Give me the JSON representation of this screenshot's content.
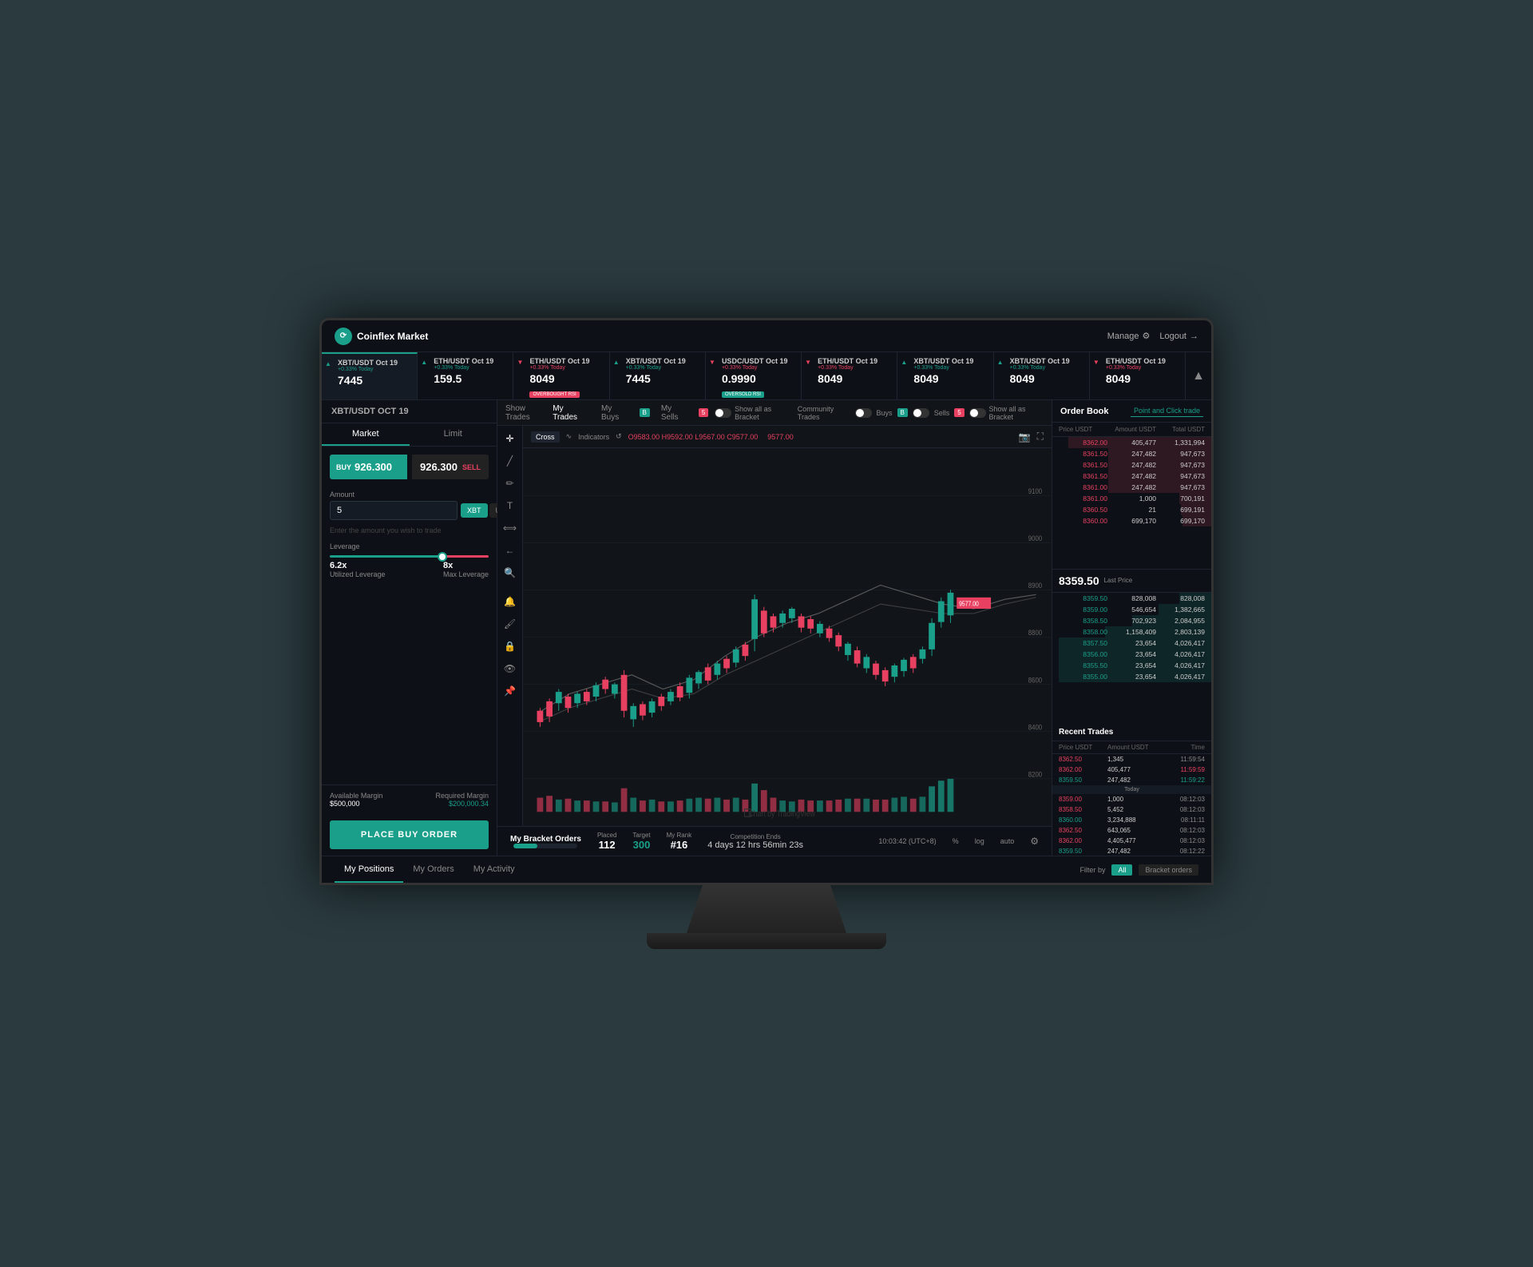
{
  "app": {
    "title": "Coinflex Market",
    "manage_label": "Manage",
    "logout_label": "Logout"
  },
  "ticker": {
    "items": [
      {
        "symbol": "XBT/USDT Oct 19",
        "change": "+0.33% Today",
        "price": "7445",
        "direction": "up",
        "badge": null
      },
      {
        "symbol": "ETH/USDT Oct 19",
        "change": "+0.33% Today",
        "price": "159.5",
        "direction": "up",
        "badge": null
      },
      {
        "symbol": "ETH/USDT Oct 19",
        "change": "+0.33% Today",
        "price": "8049",
        "direction": "down",
        "badge": "OVERBOUGHT RSI"
      },
      {
        "symbol": "XBT/USDT Oct 19",
        "change": "+0.33% Today",
        "price": "7445",
        "direction": "up",
        "badge": null
      },
      {
        "symbol": "USDC/USDT Oct 19",
        "change": "+0.33% Today",
        "price": "0.9990",
        "direction": "down",
        "badge": "OVERSOLD RSI"
      },
      {
        "symbol": "ETH/USDT Oct 19",
        "change": "+0.33% Today",
        "price": "8049",
        "direction": "down",
        "badge": null
      },
      {
        "symbol": "XBT/USDT Oct 19",
        "change": "+0.33% Today",
        "price": "8049",
        "direction": "up",
        "badge": null
      },
      {
        "symbol": "XBT/USDT Oct 19",
        "change": "+0.33% Today",
        "price": "8049",
        "direction": "up",
        "badge": null
      },
      {
        "symbol": "ETH/USDT Oct 19",
        "change": "+0.33% Today",
        "price": "8049",
        "direction": "down",
        "badge": null
      }
    ]
  },
  "left_panel": {
    "pair": "XBT/USDT OCT 19",
    "tabs": [
      "Market",
      "Limit"
    ],
    "active_tab": "Market",
    "buy_price": "926.300",
    "sell_label": "SELL",
    "buy_label": "BUY",
    "sell_price": "926.300",
    "amount_label": "Amount",
    "amount_value": "5",
    "currency_options": [
      "XBT",
      "USDT"
    ],
    "active_currency": "XBT",
    "amount_placeholder": "Enter the amount you wish to trade",
    "leverage_label": "Leverage",
    "utilized_leverage": "6.2x",
    "utilized_label": "Utilized Leverage",
    "max_leverage": "8x",
    "max_label": "Max Leverage",
    "available_margin_label": "Available Margin",
    "available_margin_val": "$500,000",
    "required_margin_label": "Required Margin",
    "required_margin_val": "$200,000.34",
    "place_order_btn": "PLACE BUY ORDER"
  },
  "chart": {
    "show_trades_label": "Show Trades",
    "my_trades_label": "My Trades",
    "my_buys_label": "My Buys",
    "buys_count": "B",
    "my_sells_label": "My Sells",
    "sells_count": "5",
    "bracket_toggle": "Show all as Bracket",
    "community_trades": "Community Trades",
    "comm_buys_label": "Buys",
    "comm_buys_count": "B",
    "comm_sells_label": "Sells",
    "comm_sells_count": "5",
    "comm_bracket": "Show all as Bracket",
    "chart_type": "Cross",
    "indicators_label": "Indicators",
    "ohlc": "O9583.00 H9592.00 L9567.00 C9577.00",
    "last_price_red": "9577.00"
  },
  "order_book": {
    "title": "Order Book",
    "tab_point_click": "Point and Click trade",
    "col_price": "Price USDT",
    "col_amount": "Amount USDT",
    "col_total": "Total USDT",
    "asks": [
      {
        "price": "8362.00",
        "amount": "405,477",
        "total": "1,331,994"
      },
      {
        "price": "8361.50",
        "amount": "247,482",
        "total": "947,673"
      },
      {
        "price": "8361.50",
        "amount": "247,482",
        "total": "947,673"
      },
      {
        "price": "8361.50",
        "amount": "247,482",
        "total": "947,673"
      },
      {
        "price": "8361.00",
        "amount": "247,482",
        "total": "947,673"
      },
      {
        "price": "8361.00",
        "amount": "1,000",
        "total": "700,191"
      },
      {
        "price": "8360.50",
        "amount": "21",
        "total": "699,191"
      },
      {
        "price": "8360.00",
        "amount": "699,170",
        "total": "699,170"
      }
    ],
    "last_price": "8359.50",
    "last_price_label": "Last Price",
    "bids": [
      {
        "price": "8359.50",
        "amount": "828,008",
        "total": "828,008"
      },
      {
        "price": "8359.00",
        "amount": "546,654",
        "total": "1,382,665"
      },
      {
        "price": "8358.50",
        "amount": "702,923",
        "total": "2,084,955"
      },
      {
        "price": "8358.00",
        "amount": "1,158,409",
        "total": "2,803,139"
      },
      {
        "price": "8357.50",
        "amount": "23,654",
        "total": "4,026,417"
      },
      {
        "price": "8356.00",
        "amount": "23,654",
        "total": "4,026,417"
      },
      {
        "price": "8355.50",
        "amount": "23,654",
        "total": "4,026,417"
      },
      {
        "price": "8355.00",
        "amount": "23,654",
        "total": "4,026,417"
      }
    ],
    "recent_trades_title": "Recent Trades",
    "rt_col_price": "Price USDT",
    "rt_col_amount": "Amount USDT",
    "rt_col_time": "Time",
    "recent_trades": [
      {
        "price": "8362.50",
        "amount": "1,345",
        "time": "11:59:54",
        "type": "ask"
      },
      {
        "price": "8362.00",
        "amount": "405,477",
        "time": "11:59:59",
        "type": "ask"
      },
      {
        "price": "8359.50",
        "amount": "247,482",
        "time": "11:59:22",
        "type": "bid"
      },
      {
        "date_sep": "Today"
      },
      {
        "price": "8359.00",
        "amount": "1,000",
        "time": "08:12:03",
        "type": "ask"
      },
      {
        "price": "8358.50",
        "amount": "5,452",
        "time": "08:12:03",
        "type": "ask"
      },
      {
        "price": "8360.00",
        "amount": "3,234,888",
        "time": "08:11:11",
        "type": "bid"
      },
      {
        "price": "8362.50",
        "amount": "643,065",
        "time": "08:12:03",
        "type": "ask"
      },
      {
        "price": "8362.00",
        "amount": "4,405,477",
        "time": "08:12:03",
        "type": "ask"
      },
      {
        "price": "8359.50",
        "amount": "247,482",
        "time": "08:12:22",
        "type": "bid"
      }
    ]
  },
  "bracket_orders": {
    "title": "My Bracket Orders",
    "placed_label": "Placed",
    "placed_val": "112",
    "target_label": "Target",
    "target_val": "300",
    "rank_label": "My Rank",
    "rank_val": "#16",
    "competition_label": "Competition Ends",
    "timer": "4 days 12 hrs 56min 23s",
    "time_display": "10:03:42 (UTC+8)",
    "progress_pct": 37,
    "chart_watermark": "Chart by TradingView"
  },
  "bottom_tabs": {
    "tabs": [
      "My Positions",
      "My Orders",
      "My Activity"
    ],
    "active_tab": "My Positions",
    "filter_label": "Filter by",
    "filter_all": "All",
    "filter_bracket": "Bracket orders"
  }
}
